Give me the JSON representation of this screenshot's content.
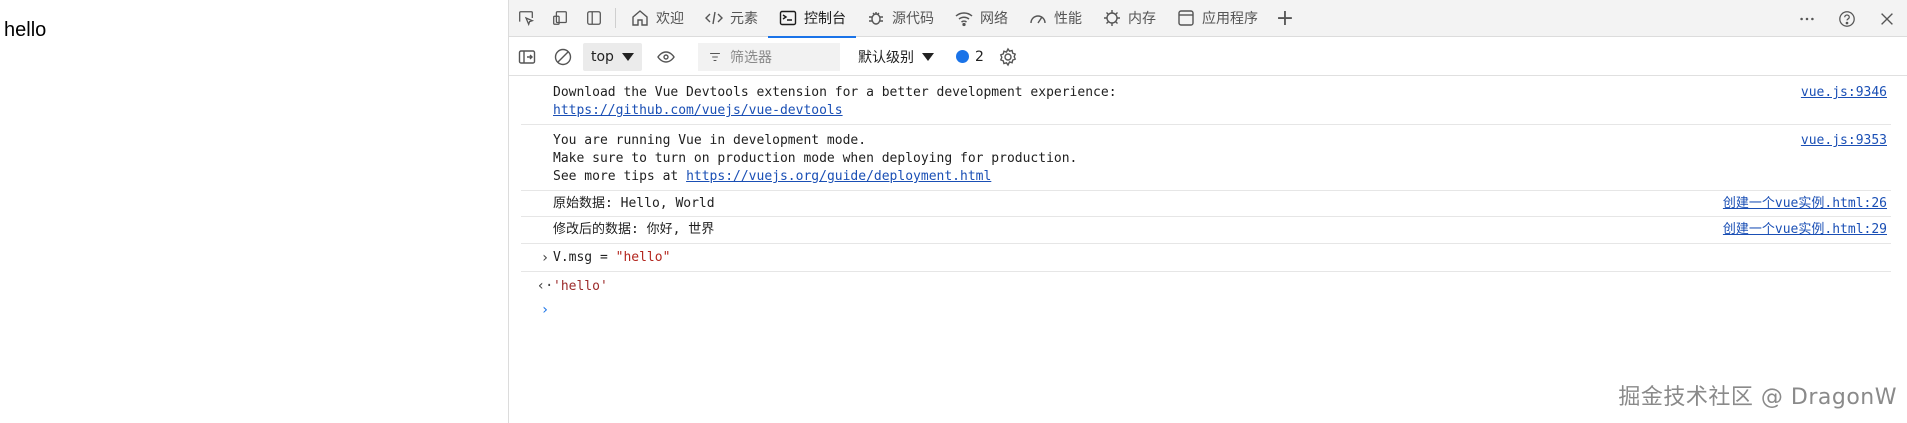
{
  "page": {
    "text": "hello"
  },
  "tabs": [
    {
      "label": "欢迎",
      "icon": "home-icon"
    },
    {
      "label": "元素",
      "icon": "code-icon"
    },
    {
      "label": "控制台",
      "icon": "console-icon",
      "active": true
    },
    {
      "label": "源代码",
      "icon": "bug-icon"
    },
    {
      "label": "网络",
      "icon": "wifi-icon"
    },
    {
      "label": "性能",
      "icon": "gauge-icon"
    },
    {
      "label": "内存",
      "icon": "memory-icon"
    },
    {
      "label": "应用程序",
      "icon": "application-icon"
    }
  ],
  "toolbar": {
    "context": "top",
    "filter_placeholder": "筛选器",
    "level": "默认级别",
    "issues_count": "2"
  },
  "console": {
    "messages": [
      {
        "lines": [
          "Download the Vue Devtools extension for a better development experience:"
        ],
        "link": "https://github.com/vuejs/vue-devtools",
        "source": "vue.js:9346"
      },
      {
        "lines": [
          "You are running Vue in development mode.",
          "Make sure to turn on production mode when deploying for production."
        ],
        "tip_prefix": "See more tips at ",
        "link": "https://vuejs.org/guide/deployment.html",
        "source": "vue.js:9353"
      },
      {
        "text": "原始数据: Hello, World",
        "source": "创建一个vue实例.html:26"
      },
      {
        "text": "修改后的数据: 你好, 世界",
        "source": "创建一个vue实例.html:29"
      }
    ],
    "command": {
      "expr": "V.msg = ",
      "value": "\"hello\""
    },
    "result": "'hello'"
  },
  "watermark": "掘金技术社区 @ DragonW",
  "colors": {
    "accent": "#1a73e8",
    "link": "#1a4fb5",
    "string": "#b3261e"
  }
}
